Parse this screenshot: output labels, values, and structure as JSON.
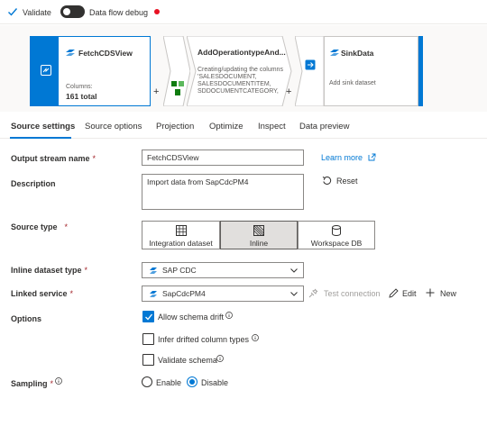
{
  "toolbar": {
    "validate_label": "Validate",
    "debug_label": "Data flow debug",
    "debug_on": false,
    "status_color": "#e81123"
  },
  "flow": {
    "source_node": {
      "title": "FetchCDSView",
      "columns_label": "Columns:",
      "columns_value": "161 total"
    },
    "transform_node": {
      "title": "AddOperationtypeAnd...",
      "description_lines": [
        "Creating/updating the columns",
        "'SALESDOCUMENT,",
        "SALESDOCUMENTITEM,",
        "SDDOCUMENTCATEGORY,"
      ]
    },
    "sink_node": {
      "title": "SinkData",
      "description": "Add sink dataset"
    },
    "add_symbol": "+"
  },
  "tabs": [
    {
      "label": "Source settings",
      "active": true
    },
    {
      "label": "Source options",
      "active": false
    },
    {
      "label": "Projection",
      "active": false
    },
    {
      "label": "Optimize",
      "active": false
    },
    {
      "label": "Inspect",
      "active": false
    },
    {
      "label": "Data preview",
      "active": false
    }
  ],
  "form": {
    "output_stream": {
      "label": "Output stream name",
      "required_mark": "*",
      "value": "FetchCDSView",
      "learn_more": "Learn more"
    },
    "description": {
      "label": "Description",
      "value": "Import data from SapCdcPM4",
      "reset_label": "Reset"
    },
    "source_type": {
      "label": "Source type",
      "required_mark": "*",
      "options": [
        {
          "label": "Integration dataset",
          "icon": "table-icon",
          "selected": false
        },
        {
          "label": "Inline",
          "icon": "inline-icon",
          "selected": true
        },
        {
          "label": "Workspace DB",
          "icon": "database-icon",
          "selected": false
        }
      ]
    },
    "inline_dataset_type": {
      "label": "Inline dataset type",
      "required_mark": "*",
      "value": "SAP CDC"
    },
    "linked_service": {
      "label": "Linked service",
      "required_mark": "*",
      "value": "SapCdcPM4",
      "test_connection": "Test connection",
      "edit": "Edit",
      "new": "New"
    },
    "options": {
      "label": "Options",
      "items": [
        {
          "label": "Allow schema drift",
          "checked": true
        },
        {
          "label": "Infer drifted column types",
          "checked": false
        },
        {
          "label": "Validate schema",
          "checked": false
        }
      ]
    },
    "sampling": {
      "label": "Sampling",
      "required_mark": "*",
      "enable": "Enable",
      "disable": "Disable",
      "selected": "Disable"
    }
  },
  "colors": {
    "accent": "#0078d4",
    "required": "#a4262c"
  }
}
